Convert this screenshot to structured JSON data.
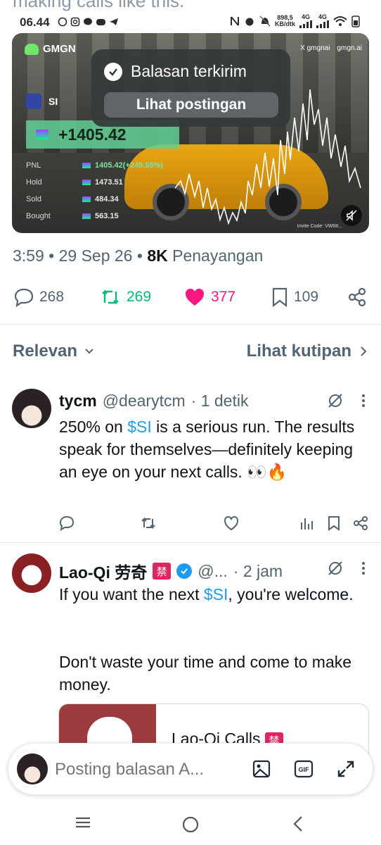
{
  "overflow_text": "making calls like this.",
  "status_bar": {
    "time": "06.44",
    "speed_value": "898,5",
    "speed_unit": "KB/dtk",
    "net1": "4G",
    "net2": "4G"
  },
  "media": {
    "brand": "GMGN",
    "handle_x": "X gmgnai",
    "handle_site": "gmgn.ai",
    "token": "SI",
    "pnl_value": "+1405.42",
    "stats": [
      {
        "label": "PNL",
        "value": "1405.42(+249.55%)"
      },
      {
        "label": "Hold",
        "value": "1473.51"
      },
      {
        "label": "Sold",
        "value": "484.34"
      },
      {
        "label": "Bought",
        "value": "563.15"
      }
    ],
    "invite": "Invite Code: VW6tt..."
  },
  "toast": {
    "title": "Balasan terkirim",
    "button": "Lihat postingan"
  },
  "post_meta": {
    "time_date": "3:59 • 29 Sep 26 •",
    "views_count": "8K",
    "views_label": "Penayangan"
  },
  "actions": {
    "replies": "268",
    "reposts": "269",
    "likes": "377",
    "bookmarks": "109"
  },
  "sort": {
    "left": "Relevan",
    "right": "Lihat kutipan"
  },
  "replies": [
    {
      "name": "tycm",
      "handle": "@dearytcm",
      "time": "· 1 detik",
      "text_before": "250% on ",
      "cashtag": "$SI",
      "text_after": " is a serious run. The results speak for themselves—definitely keeping an eye on your next calls. 👀🔥"
    },
    {
      "name": "Lao-Qi 劳奇",
      "badge": "禁",
      "handle": "@...",
      "time": "· 2 jam",
      "line1_before": "If you want the next ",
      "cashtag": "$SI",
      "line1_after": ", you're welcome.",
      "line2": "Don't waste your time and come to make money.",
      "quote_title": "Lao-Qi Calls",
      "quote_badge": "禁"
    }
  ],
  "composer": {
    "placeholder": "Posting balasan A..."
  },
  "icons": {
    "reply": "reply-icon",
    "repost": "repost-icon",
    "like": "heart-icon",
    "bookmark": "bookmark-icon",
    "share": "share-icon",
    "views": "analytics-icon",
    "grok": "grok-icon",
    "more": "more-icon",
    "image": "image-icon",
    "gif": "gif-icon",
    "expand": "expand-icon"
  },
  "colors": {
    "repost": "#00ba7c",
    "like": "#f91880",
    "cashtag": "#1d9bf0",
    "muted": "#536471"
  }
}
